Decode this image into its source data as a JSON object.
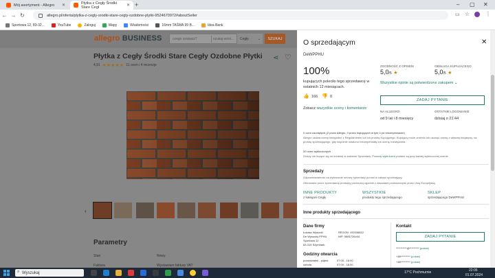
{
  "browser": {
    "tabs": [
      {
        "label": "Mój asortyment - Allegro"
      },
      {
        "label": "Płytka z Cegły Środki Stare Cegł"
      }
    ],
    "url": "allegro.pl/oferta/plytka-z-cegly-srodki-stare-cegly-ozdobne-plytki-9524670972#aboutSeller",
    "bookmarks": [
      "Sportowa 12, 83-32...",
      "YouTube",
      "Zaloguj",
      "Mapy",
      "Wiadomości",
      "16mm TAŚMA 99 B...",
      "Idea Bank"
    ]
  },
  "header": {
    "logo_allegro": "allegro",
    "logo_business": " BUSINESS",
    "search_placeholder": "czego szukasz?",
    "search_scope": "szukaj wśró...",
    "category": "Cegły",
    "search_button": "SZUKAJ"
  },
  "product": {
    "title": "Płytka z Cegły Środki Stare Cegły Ozdobne Płytki",
    "rating_value": "4,91",
    "stars": "★★★★★",
    "rating_text": "11 ocen i 4 recenzje"
  },
  "parameters": {
    "heading": "Parametry",
    "rows": [
      {
        "label": "Stan",
        "value": "Nowy"
      },
      {
        "label": "Faktura",
        "value": "Wystawiam fakturę VAT"
      }
    ]
  },
  "panel": {
    "title": "O sprzedającym",
    "seller_name": "DeWPPHU",
    "recommend_pct": "100%",
    "recommend_desc": "kupujących poleciło tego sprzedawcę w ostatnich 12 miesiącach.",
    "zgodnosc_label": "ZGODNOŚĆ Z OPISEM",
    "zgodnosc_value": "5,0",
    "zgodnosc_max": "/5",
    "obsluga_label": "OBSŁUGA KUPUJĄCEGO",
    "obsluga_value": "5,0",
    "obsluga_max": "/5",
    "star": "★",
    "opinions_link": "Wszystkie opinie są potwierdzone zakupem",
    "positive_count": "166",
    "negative_count": "0",
    "ask_button": "ZADAJ PYTANIE",
    "comments_prefix": "Zobacz ",
    "comments_link": "wszystkie oceny i komentarze",
    "on_allegro_label": "NA ALLEGRO",
    "on_allegro_value": "od 9 lat i 8 miesięcy",
    "last_login_label": "OSTATNIE LOGOWANIE",
    "last_login_value": "dzisiaj o 21:44",
    "removed_heading": "0 ocen usuniętych (Z przez Allegro, 0 przez kupujących w tym 0 po rekompensacie)",
    "removed_text": "Allegro usuwa oceny niezgodne z Regulaminem lub ich prośbą Kupującego. Kupujący może zmienić lub usunąć ocenę z własnej inicjatywy, na prośbę sprzedającego, gdy wspólnie ustalono rekompensatę lub ocenę rozwiązania.",
    "excluded_heading": "20 ocen wykluczonych",
    "excluded_text_a": "Oceny nie liczące się do średniej w zakresie Sprzedaży. Powody ",
    "excluded_link": "wykluczeń",
    "excluded_text_b": " podane są przy każdej wykluczonej ocenie.",
    "sprzedazy_heading": "Sprzedaży",
    "sprzedazy_text1": "Odpowiedzialność za wykonanie umowy sprzedaży ponosi w całości sprzedający.",
    "sprzedazy_text2": "Oferowane przez sprzedawcę produkty pochodzą zgodnie z zasadami przekazanymi przez Unię Europejską.",
    "links": [
      {
        "label": "INNE PRODUKTY",
        "sub": "z kategorii Cegły"
      },
      {
        "label": "WSZYSTKIE",
        "sub": "produkty tego sprzedającego"
      },
      {
        "label": "SKLEP",
        "sub": "sprzedającego DeWPPHU"
      }
    ],
    "other_products": "Inne produkty sprzedającego",
    "company_heading": "Dane firmy",
    "company_lines": [
      "Łukasz Wysocki",
      "De Wysocky PPHU",
      "Sportowa 12",
      "83-315 Szymbark"
    ],
    "regon": "REGON: 192036812",
    "nip": "NIP: 5881726444",
    "contact_heading": "Kontakt",
    "contact_ask": "ZADAJ PYTANIE",
    "contact_email": "**********@*********",
    "contact_email_link": "(pokaż)",
    "phone1": "+48*********",
    "phone1_link": "(pokaż)",
    "phone2": "+48*********",
    "phone2_link": "(pokaż)",
    "hours_heading": "Godziny otwarcia",
    "hours_days": "poniedziałek - piątek",
    "hours_time": "07:00 - 16:00",
    "hours_sat": "sobota",
    "hours_sat_time": "07:00 - 16:00"
  },
  "taskbar": {
    "search": "Wyszukaj",
    "weather": "17°C  Pochmurnie",
    "time": "22:05",
    "date": "01.07.2024"
  }
}
